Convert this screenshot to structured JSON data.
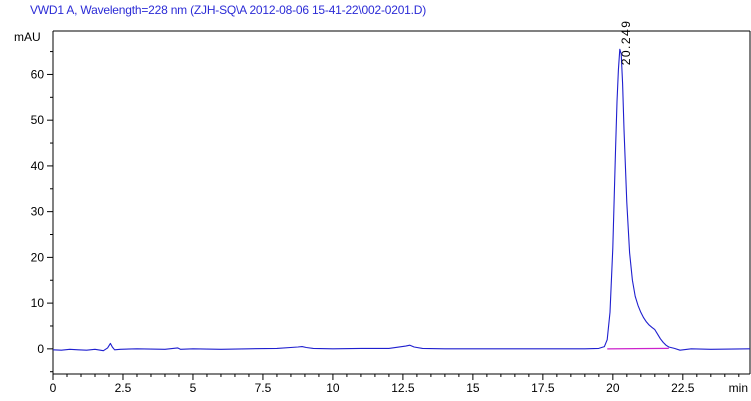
{
  "chart_data": {
    "type": "line",
    "title": "VWD1 A, Wavelength=228 nm (ZJH-SQ\\A 2012-08-06 15-41-22\\002-0201.D)",
    "ylabel": "mAU",
    "xlabel": "min",
    "xlim": [
      0,
      24.9
    ],
    "ylim": [
      -5.5,
      69.5
    ],
    "xticks": [
      0,
      2.5,
      5,
      7.5,
      10,
      12.5,
      15,
      17.5,
      20,
      22.5
    ],
    "xtick_labels": [
      "0",
      "2.5",
      "5",
      "7.5",
      "10",
      "12.5",
      "15",
      "17.5",
      "20",
      "22.5"
    ],
    "yticks": [
      0,
      10,
      20,
      30,
      40,
      50,
      60
    ],
    "ytick_labels": [
      "0",
      "10",
      "20",
      "30",
      "40",
      "50",
      "60"
    ],
    "grid": false,
    "series": [
      {
        "color": "#1f1fcf",
        "x": [
          0,
          0.3,
          0.6,
          0.9,
          1.2,
          1.5,
          1.8,
          1.95,
          2.05,
          2.12,
          2.2,
          2.4,
          3.0,
          4.0,
          4.45,
          4.55,
          5.0,
          6.0,
          7.0,
          8.0,
          8.75,
          8.9,
          9.05,
          9.3,
          10,
          11,
          12,
          12.6,
          12.75,
          12.9,
          13.2,
          14,
          15,
          16,
          17,
          18,
          19,
          19.5,
          19.7,
          19.8,
          19.9,
          20.0,
          20.05,
          20.1,
          20.15,
          20.2,
          20.249,
          20.3,
          20.35,
          20.4,
          20.5,
          20.6,
          20.7,
          20.8,
          20.9,
          21.0,
          21.1,
          21.2,
          21.3,
          21.4,
          21.5,
          21.6,
          21.7,
          21.8,
          21.9,
          22.0,
          22.2,
          22.4,
          22.8,
          23.5,
          24.9
        ],
        "y": [
          -0.2,
          -0.3,
          -0.1,
          -0.2,
          -0.3,
          -0.1,
          -0.4,
          0.2,
          1.2,
          0.4,
          -0.2,
          -0.1,
          0.0,
          -0.1,
          0.2,
          -0.1,
          0.0,
          -0.1,
          0.0,
          0.1,
          0.4,
          0.5,
          0.3,
          0.1,
          0.0,
          0.1,
          0.1,
          0.6,
          0.8,
          0.4,
          0.1,
          0.0,
          0.0,
          0.0,
          0.0,
          0.0,
          0.0,
          0.1,
          0.5,
          2.0,
          8.0,
          22.0,
          33.0,
          44.0,
          54.0,
          61.0,
          65.5,
          64.5,
          58.0,
          48.0,
          32.0,
          21.0,
          15.0,
          11.5,
          9.5,
          8.0,
          6.8,
          5.9,
          5.2,
          4.7,
          4.2,
          3.2,
          2.2,
          1.4,
          0.8,
          0.4,
          0.1,
          -0.3,
          0.0,
          -0.1,
          0.0
        ]
      }
    ],
    "baseline": {
      "color": "#cc22cc",
      "x": [
        19.8,
        22.0
      ],
      "y": [
        0.0,
        0.1
      ]
    },
    "peak_annotation": {
      "text": "20.249",
      "x": 20.249,
      "y": 65.5
    }
  }
}
